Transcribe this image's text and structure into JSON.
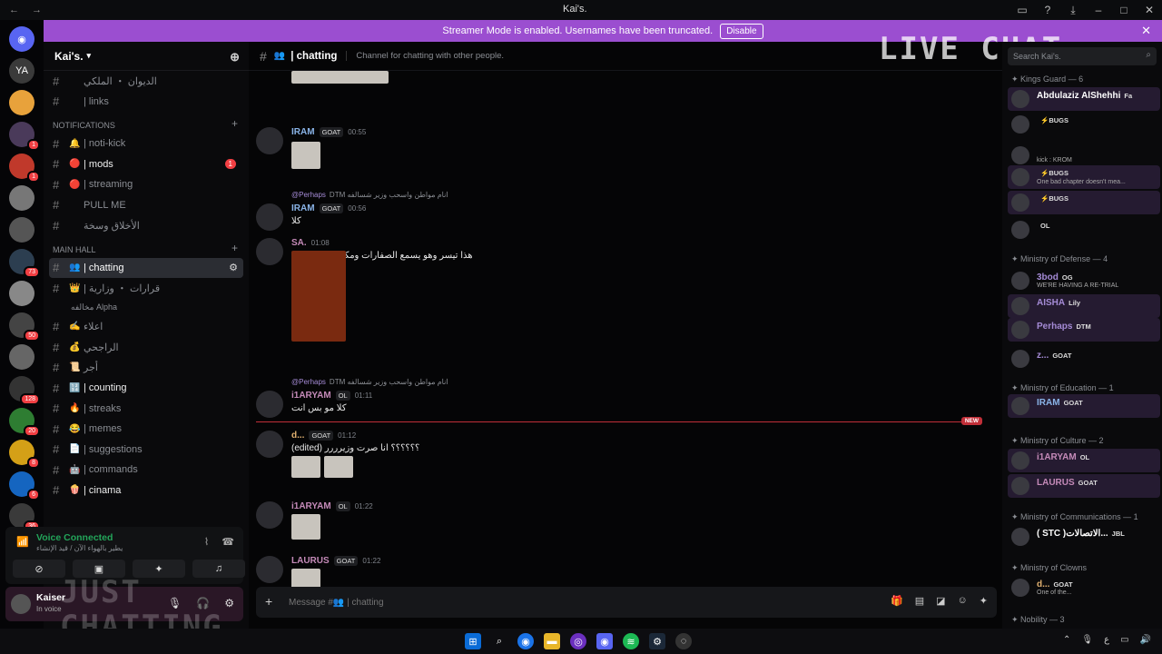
{
  "window": {
    "title": "Kai's."
  },
  "banner": {
    "text": "Streamer Mode is enabled. Usernames have been truncated.",
    "button": "Disable"
  },
  "servers": [
    {
      "label": "YA",
      "badge": ""
    },
    {
      "label": "",
      "badge": ""
    },
    {
      "label": "",
      "badge": "1"
    },
    {
      "label": "",
      "badge": "1"
    },
    {
      "label": "",
      "badge": ""
    },
    {
      "label": "",
      "badge": ""
    },
    {
      "label": "",
      "badge": "73"
    },
    {
      "label": "",
      "badge": ""
    },
    {
      "label": "",
      "badge": "50"
    },
    {
      "label": "",
      "badge": ""
    },
    {
      "label": "",
      "badge": "128"
    },
    {
      "label": "",
      "badge": "20"
    },
    {
      "label": "",
      "badge": "8"
    },
    {
      "label": "",
      "badge": "6"
    },
    {
      "label": "",
      "badge": "36"
    }
  ],
  "guild": {
    "name": "Kai's."
  },
  "channels": {
    "top": [
      {
        "name": "الديوان ・ الملكي",
        "emoji": "",
        "bold": false
      },
      {
        "name": "| links",
        "emoji": "",
        "bold": false
      }
    ],
    "notifications_label": "NOTIFICATIONS",
    "notifications": [
      {
        "name": "| noti-kick",
        "emoji": "🔔",
        "bold": false,
        "mention": ""
      },
      {
        "name": "| mods",
        "emoji": "🔴",
        "bold": true,
        "mention": "1"
      },
      {
        "name": "| streaming",
        "emoji": "🔴",
        "bold": false,
        "mention": ""
      },
      {
        "name": "PULL ME",
        "emoji": "",
        "bold": false,
        "mention": ""
      },
      {
        "name": "الأخلاق وسخة",
        "emoji": "",
        "bold": false,
        "mention": ""
      }
    ],
    "main_label": "MAIN HALL",
    "main": [
      {
        "name": "| chatting",
        "emoji": "👥",
        "bold": false
      },
      {
        "name": "| قرارات ・ وزارية",
        "emoji": "👑",
        "bold": false
      },
      {
        "name": "اعلاء",
        "emoji": "✍️",
        "bold": false
      },
      {
        "name": "الراجحي",
        "emoji": "💰",
        "bold": false
      },
      {
        "name": "أجر",
        "emoji": "📜",
        "bold": false
      },
      {
        "name": "| counting",
        "emoji": "🔢",
        "bold": true
      },
      {
        "name": "| streaks",
        "emoji": "🔥",
        "bold": false
      },
      {
        "name": "| memes",
        "emoji": "😂",
        "bold": false
      },
      {
        "name": "| suggestions",
        "emoji": "📄",
        "bold": false
      },
      {
        "name": "| commands",
        "emoji": "🤖",
        "bold": false
      },
      {
        "name": "| cinama",
        "emoji": "🍿",
        "bold": true
      }
    ],
    "sub_alpha": "مخالفه Alpha"
  },
  "voice": {
    "title": "Voice Connected",
    "subtitle": "يطير بالهواء الآن / قيد الإنشاء"
  },
  "user": {
    "name": "Kaiser",
    "status": "In voice"
  },
  "overlays": {
    "live_chat": "LIVE CHAT",
    "just": "JUST",
    "chatting": "CHATTING"
  },
  "channel_header": {
    "name": "| chatting",
    "topic": "Channel for chatting with other people."
  },
  "messages": [
    {
      "author": "IRAM",
      "role": "GOAT",
      "time": "00:55",
      "text": "",
      "reply_name": "",
      "reply_text": "",
      "color": "#8ab4e8"
    },
    {
      "author": "IRAM",
      "role": "GOAT",
      "time": "00:56",
      "text": "كلا",
      "reply_name": "@Perhaps",
      "reply_text": "DTM انام مواطن واسحب وزير شسالفه",
      "color": "#8ab4e8"
    },
    {
      "author": "SA.",
      "role": "",
      "time": "01:08",
      "text": "هذا تيسر وهو يسمع الصفارات ومكمل بث طبيعي",
      "reply_name": "",
      "reply_text": "",
      "color": "#c48ab8"
    },
    {
      "author": "i1ARYAM",
      "role": "OL",
      "time": "01:11",
      "text": "كلا مو بس انت",
      "reply_name": "@Perhaps",
      "reply_text": "DTM انام مواطن واسحب وزير شسالفه",
      "color": "#c48ab8"
    },
    {
      "author": "d...",
      "role": "GOAT",
      "time": "01:12",
      "text": "(edited) ؟؟؟؟؟؟ انا صرت وزيرررر",
      "reply_name": "",
      "reply_text": "",
      "color": "#e0b070"
    },
    {
      "author": "i1ARYAM",
      "role": "OL",
      "time": "01:22",
      "text": "",
      "reply_name": "",
      "reply_text": "",
      "color": "#c48ab8"
    },
    {
      "author": "LAURUS",
      "role": "GOAT",
      "time": "01:22",
      "text": "",
      "reply_name": "",
      "reply_text": "",
      "color": "#c48ab8"
    }
  ],
  "new_label": "NEW",
  "composer": {
    "placeholder": "Message #👥 | chatting"
  },
  "members": {
    "search_placeholder": "Search Kai's.",
    "cats": [
      "✦ Kings Guard — 6",
      "✦ Ministry of Defense — 4",
      "✦ Ministry of Education — 1",
      "✦ Ministry of Culture — 2",
      "✦ Ministry of Communications — 1",
      "✦ Ministry of Clowns",
      "✦ Nobility — 3"
    ],
    "list": [
      {
        "name": "Abdulaziz AlShehhi",
        "tag": "Fa",
        "status": "",
        "color": "#ffffff"
      },
      {
        "name": "",
        "tag": "⚡BUGS",
        "status": "",
        "color": "#ffffff"
      },
      {
        "name": "",
        "tag": "",
        "status": "kick : KROM",
        "color": "#ffffff"
      },
      {
        "name": "",
        "tag": "⚡BUGS",
        "status": "One bad chapter doesn't mea...",
        "color": "#ffffff"
      },
      {
        "name": "",
        "tag": "⚡BUGS",
        "status": "",
        "color": "#ffffff"
      },
      {
        "name": "",
        "tag": "OL",
        "status": "",
        "color": "#ffffff"
      },
      {
        "name": "3bod",
        "tag": "OG",
        "status": "WE'RE HAVING A RE-TRIAL",
        "color": "#a58bd6"
      },
      {
        "name": "AISHA",
        "tag": "Lily",
        "status": "",
        "color": "#a58bd6"
      },
      {
        "name": "Perhaps",
        "tag": "DTM",
        "status": "",
        "color": "#a58bd6"
      },
      {
        "name": "z...",
        "tag": "GOAT",
        "status": "",
        "color": "#a58bd6"
      },
      {
        "name": "IRAM",
        "tag": "GOAT",
        "status": "",
        "color": "#8ab4e8"
      },
      {
        "name": "i1ARYAM",
        "tag": "OL",
        "status": "",
        "color": "#c48ab8"
      },
      {
        "name": "LAURUS",
        "tag": "GOAT",
        "status": "",
        "color": "#c48ab8"
      },
      {
        "name": "( STC )الاتصالات...",
        "tag": "JBL",
        "status": "",
        "color": "#ffffff"
      },
      {
        "name": "d...",
        "tag": "GOAT",
        "status": "One of the...",
        "color": "#e0b070"
      }
    ]
  }
}
